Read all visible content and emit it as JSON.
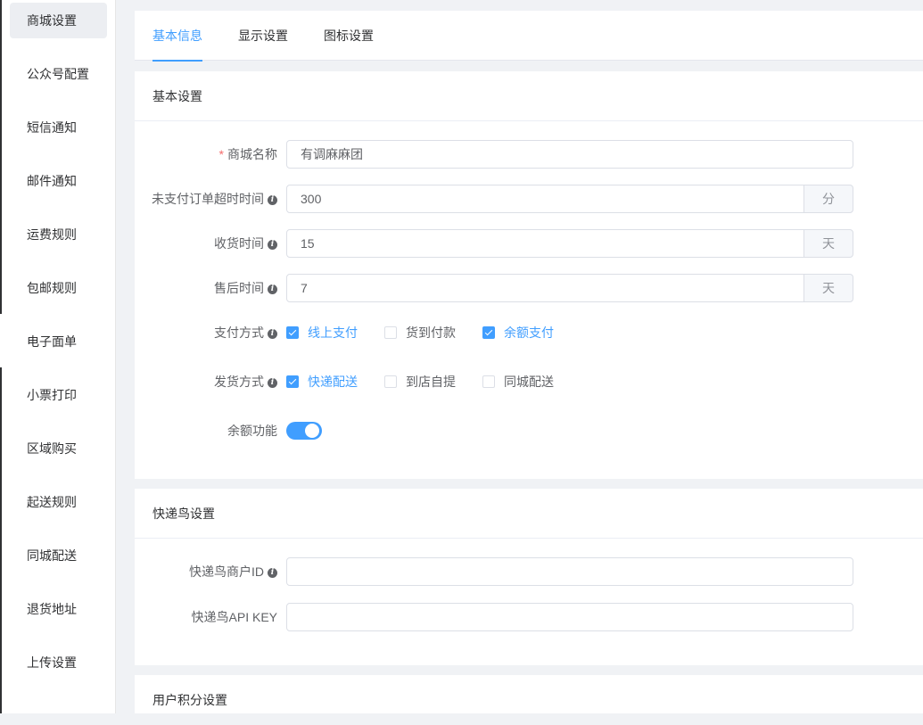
{
  "sidebar": {
    "items": [
      {
        "label": "商城设置",
        "active": true
      },
      {
        "label": "公众号配置"
      },
      {
        "label": "短信通知"
      },
      {
        "label": "邮件通知"
      },
      {
        "label": "运费规则"
      },
      {
        "label": "包邮规则"
      },
      {
        "label": "电子面单"
      },
      {
        "label": "小票打印"
      },
      {
        "label": "区域购买"
      },
      {
        "label": "起送规则"
      },
      {
        "label": "同城配送"
      },
      {
        "label": "退货地址"
      },
      {
        "label": "上传设置"
      }
    ]
  },
  "tabs": [
    {
      "label": "基本信息",
      "active": true
    },
    {
      "label": "显示设置"
    },
    {
      "label": "图标设置"
    }
  ],
  "basic": {
    "title": "基本设置",
    "shop_name": {
      "label": "商城名称",
      "required_mark": "*",
      "value": "有调麻麻团"
    },
    "unpaid_timeout": {
      "label": "未支付订单超时时间",
      "value": "300",
      "unit": "分"
    },
    "receive_time": {
      "label": "收货时间",
      "value": "15",
      "unit": "天"
    },
    "aftersale_time": {
      "label": "售后时间",
      "value": "7",
      "unit": "天"
    },
    "payment": {
      "label": "支付方式",
      "options": [
        {
          "label": "线上支付",
          "checked": true
        },
        {
          "label": "货到付款",
          "checked": false
        },
        {
          "label": "余额支付",
          "checked": true
        }
      ]
    },
    "delivery": {
      "label": "发货方式",
      "options": [
        {
          "label": "快递配送",
          "checked": true
        },
        {
          "label": "到店自提",
          "checked": false
        },
        {
          "label": "同城配送",
          "checked": false
        }
      ]
    },
    "balance": {
      "label": "余额功能",
      "enabled": true
    }
  },
  "kdn": {
    "title": "快递鸟设置",
    "merchant_id": {
      "label": "快递鸟商户ID",
      "value": ""
    },
    "api_key": {
      "label": "快递鸟API KEY",
      "value": ""
    }
  },
  "points": {
    "title": "用户积分设置"
  },
  "icons": {
    "info": "info-circle-icon"
  },
  "colors": {
    "accent": "#409eff",
    "required": "#f56c6c"
  }
}
